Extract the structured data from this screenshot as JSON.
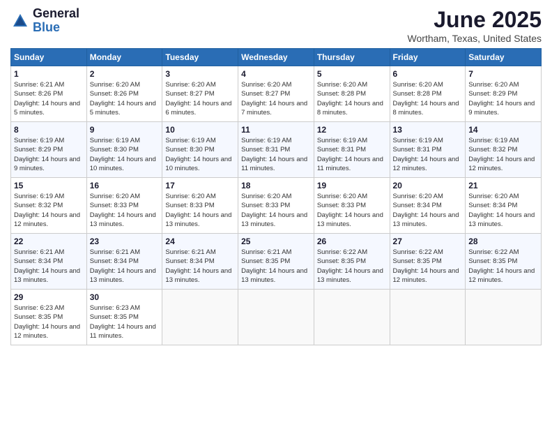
{
  "logo": {
    "general": "General",
    "blue": "Blue"
  },
  "title": {
    "month": "June 2025",
    "location": "Wortham, Texas, United States"
  },
  "headers": [
    "Sunday",
    "Monday",
    "Tuesday",
    "Wednesday",
    "Thursday",
    "Friday",
    "Saturday"
  ],
  "weeks": [
    [
      {
        "day": "1",
        "sunrise": "6:21 AM",
        "sunset": "8:26 PM",
        "daylight": "14 hours and 5 minutes."
      },
      {
        "day": "2",
        "sunrise": "6:20 AM",
        "sunset": "8:26 PM",
        "daylight": "14 hours and 5 minutes."
      },
      {
        "day": "3",
        "sunrise": "6:20 AM",
        "sunset": "8:27 PM",
        "daylight": "14 hours and 6 minutes."
      },
      {
        "day": "4",
        "sunrise": "6:20 AM",
        "sunset": "8:27 PM",
        "daylight": "14 hours and 7 minutes."
      },
      {
        "day": "5",
        "sunrise": "6:20 AM",
        "sunset": "8:28 PM",
        "daylight": "14 hours and 8 minutes."
      },
      {
        "day": "6",
        "sunrise": "6:20 AM",
        "sunset": "8:28 PM",
        "daylight": "14 hours and 8 minutes."
      },
      {
        "day": "7",
        "sunrise": "6:20 AM",
        "sunset": "8:29 PM",
        "daylight": "14 hours and 9 minutes."
      }
    ],
    [
      {
        "day": "8",
        "sunrise": "6:19 AM",
        "sunset": "8:29 PM",
        "daylight": "14 hours and 9 minutes."
      },
      {
        "day": "9",
        "sunrise": "6:19 AM",
        "sunset": "8:30 PM",
        "daylight": "14 hours and 10 minutes."
      },
      {
        "day": "10",
        "sunrise": "6:19 AM",
        "sunset": "8:30 PM",
        "daylight": "14 hours and 10 minutes."
      },
      {
        "day": "11",
        "sunrise": "6:19 AM",
        "sunset": "8:31 PM",
        "daylight": "14 hours and 11 minutes."
      },
      {
        "day": "12",
        "sunrise": "6:19 AM",
        "sunset": "8:31 PM",
        "daylight": "14 hours and 11 minutes."
      },
      {
        "day": "13",
        "sunrise": "6:19 AM",
        "sunset": "8:31 PM",
        "daylight": "14 hours and 12 minutes."
      },
      {
        "day": "14",
        "sunrise": "6:19 AM",
        "sunset": "8:32 PM",
        "daylight": "14 hours and 12 minutes."
      }
    ],
    [
      {
        "day": "15",
        "sunrise": "6:19 AM",
        "sunset": "8:32 PM",
        "daylight": "14 hours and 12 minutes."
      },
      {
        "day": "16",
        "sunrise": "6:20 AM",
        "sunset": "8:33 PM",
        "daylight": "14 hours and 13 minutes."
      },
      {
        "day": "17",
        "sunrise": "6:20 AM",
        "sunset": "8:33 PM",
        "daylight": "14 hours and 13 minutes."
      },
      {
        "day": "18",
        "sunrise": "6:20 AM",
        "sunset": "8:33 PM",
        "daylight": "14 hours and 13 minutes."
      },
      {
        "day": "19",
        "sunrise": "6:20 AM",
        "sunset": "8:33 PM",
        "daylight": "14 hours and 13 minutes."
      },
      {
        "day": "20",
        "sunrise": "6:20 AM",
        "sunset": "8:34 PM",
        "daylight": "14 hours and 13 minutes."
      },
      {
        "day": "21",
        "sunrise": "6:20 AM",
        "sunset": "8:34 PM",
        "daylight": "14 hours and 13 minutes."
      }
    ],
    [
      {
        "day": "22",
        "sunrise": "6:21 AM",
        "sunset": "8:34 PM",
        "daylight": "14 hours and 13 minutes."
      },
      {
        "day": "23",
        "sunrise": "6:21 AM",
        "sunset": "8:34 PM",
        "daylight": "14 hours and 13 minutes."
      },
      {
        "day": "24",
        "sunrise": "6:21 AM",
        "sunset": "8:34 PM",
        "daylight": "14 hours and 13 minutes."
      },
      {
        "day": "25",
        "sunrise": "6:21 AM",
        "sunset": "8:35 PM",
        "daylight": "14 hours and 13 minutes."
      },
      {
        "day": "26",
        "sunrise": "6:22 AM",
        "sunset": "8:35 PM",
        "daylight": "14 hours and 13 minutes."
      },
      {
        "day": "27",
        "sunrise": "6:22 AM",
        "sunset": "8:35 PM",
        "daylight": "14 hours and 12 minutes."
      },
      {
        "day": "28",
        "sunrise": "6:22 AM",
        "sunset": "8:35 PM",
        "daylight": "14 hours and 12 minutes."
      }
    ],
    [
      {
        "day": "29",
        "sunrise": "6:23 AM",
        "sunset": "8:35 PM",
        "daylight": "14 hours and 12 minutes."
      },
      {
        "day": "30",
        "sunrise": "6:23 AM",
        "sunset": "8:35 PM",
        "daylight": "14 hours and 11 minutes."
      },
      null,
      null,
      null,
      null,
      null
    ]
  ],
  "labels": {
    "sunrise": "Sunrise:",
    "sunset": "Sunset:",
    "daylight": "Daylight: "
  }
}
